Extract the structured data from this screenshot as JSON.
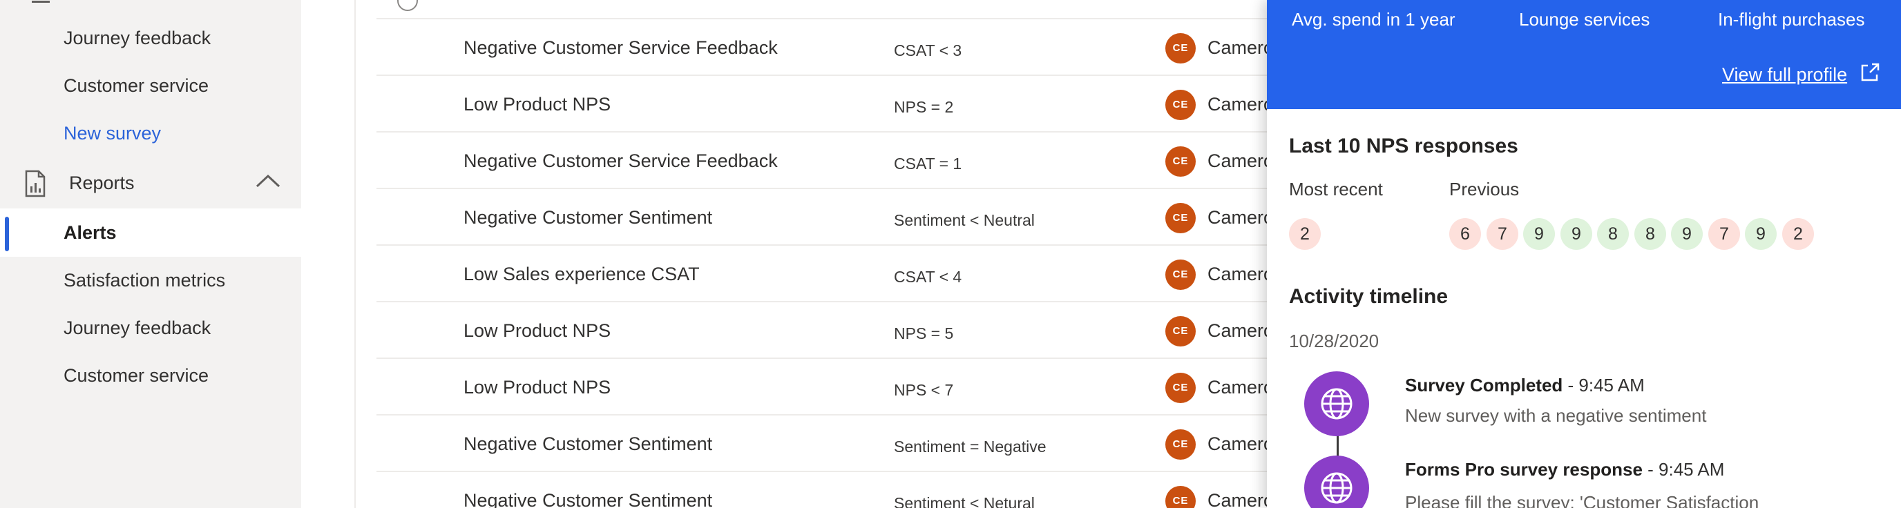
{
  "nav": {
    "items_top": [
      {
        "label": "Journey feedback"
      },
      {
        "label": "Customer service"
      },
      {
        "label": "New survey"
      }
    ],
    "reports_label": "Reports",
    "items_reports": [
      {
        "label": "Alerts"
      },
      {
        "label": "Satisfaction metrics"
      },
      {
        "label": "Journey feedback"
      },
      {
        "label": "Customer service"
      }
    ]
  },
  "alerts": [
    {
      "name": "Negative Customer Service Feedback",
      "condition": "CSAT < 3",
      "owner_initials": "CE",
      "owner": "Camero"
    },
    {
      "name": "Low Product NPS",
      "condition": "NPS = 2",
      "owner_initials": "CE",
      "owner": "Camero"
    },
    {
      "name": "Negative Customer Service Feedback",
      "condition": "CSAT = 1",
      "owner_initials": "CE",
      "owner": "Camero"
    },
    {
      "name": "Negative Customer Sentiment",
      "condition": "Sentiment < Neutral",
      "owner_initials": "CE",
      "owner": "Camero"
    },
    {
      "name": "Low Sales experience CSAT",
      "condition": "CSAT < 4",
      "owner_initials": "CE",
      "owner": "Camero"
    },
    {
      "name": "Low Product NPS",
      "condition": "NPS = 5",
      "owner_initials": "CE",
      "owner": "Camero"
    },
    {
      "name": "Low Product NPS",
      "condition": "NPS < 7",
      "owner_initials": "CE",
      "owner": "Camero"
    },
    {
      "name": "Negative Customer Sentiment",
      "condition": "Sentiment = Negative",
      "owner_initials": "CE",
      "owner": "Camero"
    },
    {
      "name": "Negative Customer Sentiment",
      "condition": "Sentiment < Netural",
      "owner_initials": "CE",
      "owner": "Camero"
    }
  ],
  "panel": {
    "header": {
      "avg_spend_label": "Avg. spend in 1 year",
      "lounge_label": "Lounge services",
      "inflight_label": "In-flight purchases",
      "view_profile": "View full profile"
    },
    "nps": {
      "title": "Last 10 NPS responses",
      "most_recent_label": "Most recent",
      "previous_label": "Previous",
      "most_recent": "2",
      "previous": [
        "6",
        "7",
        "9",
        "9",
        "8",
        "8",
        "9",
        "7",
        "9",
        "2"
      ]
    },
    "timeline": {
      "title": "Activity timeline",
      "date": "10/28/2020",
      "events": [
        {
          "title": "Survey Completed",
          "time": " - 9:45 AM",
          "desc": "New survey with a negative sentiment"
        },
        {
          "title": "Forms Pro survey response",
          "time": " - 9:45 AM",
          "desc": "Please fill the survey: 'Customer Satisfaction"
        }
      ]
    }
  },
  "colors": {
    "accent": "#2563eb",
    "avatar": "#ca5010",
    "timeline": "#8a3ec8",
    "nps_low": "#fde0db",
    "nps_high": "#dff3dc"
  }
}
